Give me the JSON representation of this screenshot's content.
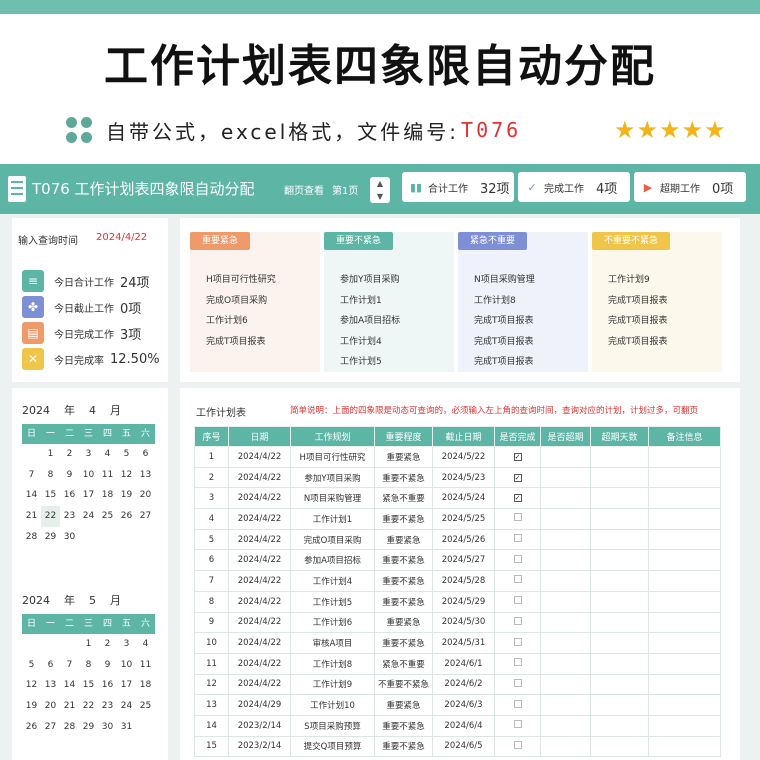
{
  "banner": {
    "title": "工作计划表四象限自动分配",
    "subtitle": "自带公式，excel格式，文件编号:",
    "code": "T076",
    "stars": "★★★★★"
  },
  "header": {
    "app_title": "T076 工作计划表四象限自动分配",
    "page_label": "翻页查看",
    "page_value": "第1页",
    "spin_up": "▲",
    "spin_down": "▼",
    "stats": {
      "total": {
        "label": "合计工作",
        "value": "32项"
      },
      "done": {
        "label": "完成工作",
        "value": "4项"
      },
      "overdue": {
        "label": "超期工作",
        "value": "0项"
      }
    }
  },
  "query": {
    "label": "输入查询时间",
    "date": "2024/4/22"
  },
  "kpis": [
    {
      "label": "今日合计工作",
      "value": "24项",
      "color": "#5db5a6"
    },
    {
      "label": "今日截止工作",
      "value": "0项",
      "color": "#7f8fd6"
    },
    {
      "label": "今日完成工作",
      "value": "3项",
      "color": "#ee9a6a"
    },
    {
      "label": "今日完成率",
      "value": "12.50%",
      "color": "#f0c64a"
    }
  ],
  "quadrants": [
    {
      "tag": "重要紧急",
      "color": "#ee9a6a",
      "bg": "#fdf3ee",
      "items": [
        "H项目可行性研究",
        "完成O项目采购",
        "工作计划6",
        "完成T项目报表"
      ]
    },
    {
      "tag": "重要不紧急",
      "color": "#5db5a6",
      "bg": "#eef7f5",
      "items": [
        "参加Y项目采购",
        "工作计划1",
        "参加A项目招标",
        "工作计划4",
        "工作计划5"
      ]
    },
    {
      "tag": "紧急不重要",
      "color": "#7f8fd6",
      "bg": "#f0f2fb",
      "items": [
        "N项目采购管理",
        "工作计划8",
        "完成T项目报表",
        "完成T项目报表",
        "完成T项目报表"
      ]
    },
    {
      "tag": "不重要不紧急",
      "color": "#f0c64a",
      "bg": "#fdf8ec",
      "items": [
        "工作计划9",
        "完成T项目报表",
        "完成T项目报表",
        "完成T项目报表"
      ]
    }
  ],
  "calendars": [
    {
      "year": "2024",
      "year_unit": "年",
      "month": "4",
      "month_unit": "月",
      "weekdays": [
        "日",
        "一",
        "二",
        "三",
        "四",
        "五",
        "六"
      ],
      "days": [
        "",
        "1",
        "2",
        "3",
        "4",
        "5",
        "6",
        "7",
        "8",
        "9",
        "10",
        "11",
        "12",
        "13",
        "14",
        "15",
        "16",
        "17",
        "18",
        "19",
        "20",
        "21",
        "22",
        "23",
        "24",
        "25",
        "26",
        "27",
        "28",
        "29",
        "30"
      ],
      "today": "22"
    },
    {
      "year": "2024",
      "year_unit": "年",
      "month": "5",
      "month_unit": "月",
      "weekdays": [
        "日",
        "一",
        "二",
        "三",
        "四",
        "五",
        "六"
      ],
      "days": [
        "",
        "",
        "",
        "1",
        "2",
        "3",
        "4",
        "5",
        "6",
        "7",
        "8",
        "9",
        "10",
        "11",
        "12",
        "13",
        "14",
        "15",
        "16",
        "17",
        "18",
        "19",
        "20",
        "21",
        "22",
        "23",
        "24",
        "25",
        "26",
        "27",
        "28",
        "29",
        "30",
        "31"
      ],
      "today": ""
    }
  ],
  "table": {
    "title": "工作计划表",
    "note": "简单说明：上面的四象限是动态可查询的，必须输入左上角的查询时间，查询对应的计划，计划过多，可翻页",
    "columns": [
      "序号",
      "日期",
      "工作规划",
      "重要程度",
      "截止日期",
      "是否完成",
      "是否超期",
      "超期天数",
      "备注信息"
    ],
    "rows": [
      [
        "1",
        "2024/4/22",
        "H项目可行性研究",
        "重要紧急",
        "2024/5/22",
        true
      ],
      [
        "2",
        "2024/4/22",
        "参加Y项目采购",
        "重要不紧急",
        "2024/5/23",
        true
      ],
      [
        "3",
        "2024/4/22",
        "N项目采购管理",
        "紧急不重要",
        "2024/5/24",
        true
      ],
      [
        "4",
        "2024/4/22",
        "工作计划1",
        "重要不紧急",
        "2024/5/25",
        false
      ],
      [
        "5",
        "2024/4/22",
        "完成O项目采购",
        "重要紧急",
        "2024/5/26",
        false
      ],
      [
        "6",
        "2024/4/22",
        "参加A项目招标",
        "重要不紧急",
        "2024/5/27",
        false
      ],
      [
        "7",
        "2024/4/22",
        "工作计划4",
        "重要不紧急",
        "2024/5/28",
        false
      ],
      [
        "8",
        "2024/4/22",
        "工作计划5",
        "重要不紧急",
        "2024/5/29",
        false
      ],
      [
        "9",
        "2024/4/22",
        "工作计划6",
        "重要紧急",
        "2024/5/30",
        false
      ],
      [
        "10",
        "2024/4/22",
        "审核A项目",
        "重要不紧急",
        "2024/5/31",
        false
      ],
      [
        "11",
        "2024/4/22",
        "工作计划8",
        "紧急不重要",
        "2024/6/1",
        false
      ],
      [
        "12",
        "2024/4/22",
        "工作计划9",
        "不重要不紧急",
        "2024/6/2",
        false
      ],
      [
        "13",
        "2024/4/29",
        "工作计划10",
        "重要紧急",
        "2024/6/3",
        false
      ],
      [
        "14",
        "2023/2/14",
        "S项目采购预算",
        "重要不紧急",
        "2024/6/4",
        false
      ],
      [
        "15",
        "2023/2/14",
        "提交Q项目预算",
        "重要不紧急",
        "2024/6/5",
        false
      ]
    ]
  }
}
